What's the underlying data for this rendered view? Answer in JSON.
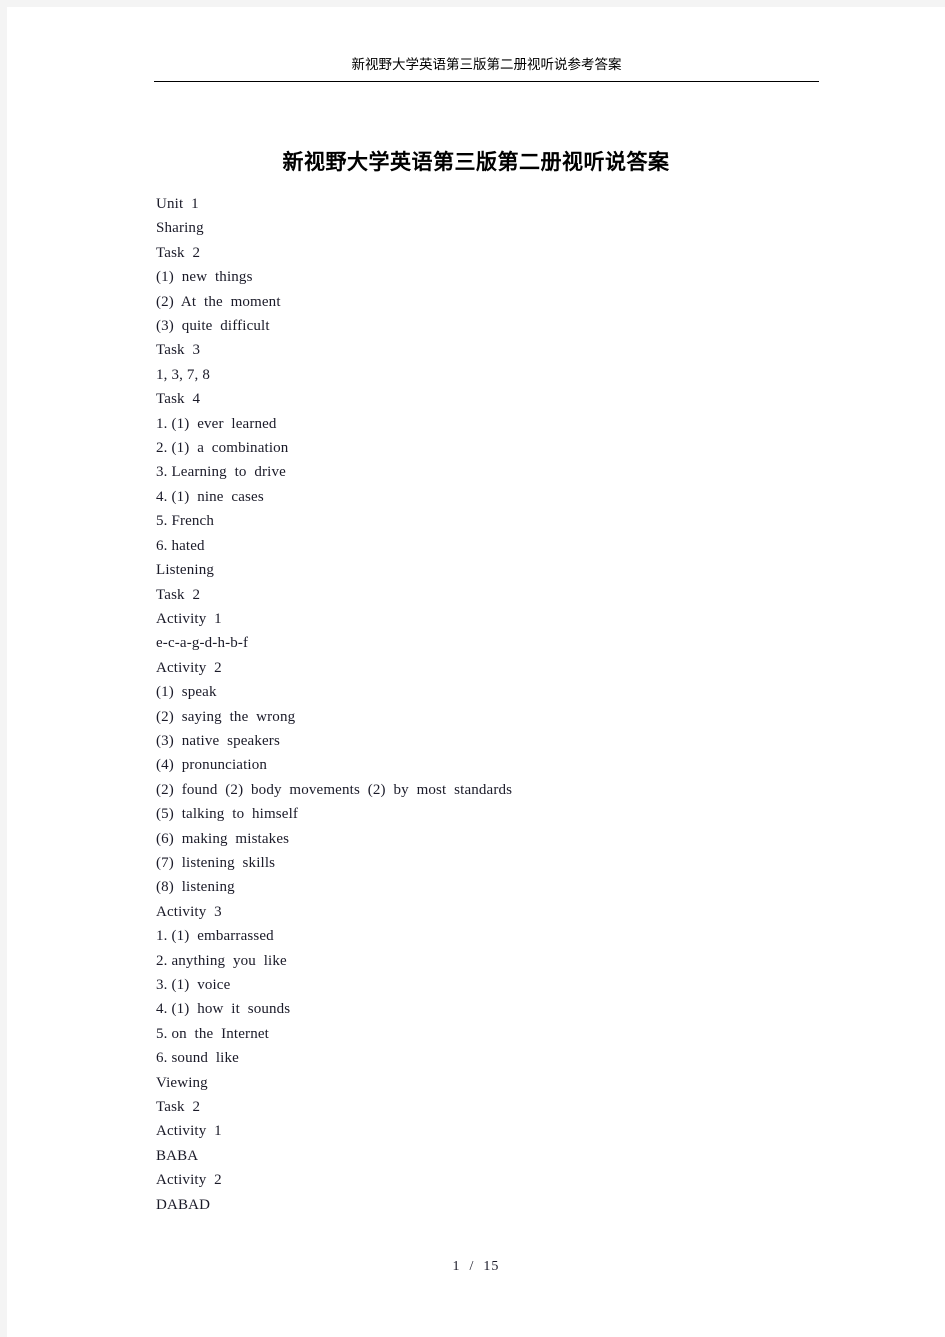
{
  "page": {
    "background_color": "#ffffff",
    "canvas_color": "#f4f4f4"
  },
  "header": {
    "text": "新视野大学英语第三版第二册视听说参考答案",
    "rule_color": "#000000"
  },
  "title": {
    "text": "新视野大学英语第三版第二册视听说答案"
  },
  "body": {
    "lines": [
      "Unit  1",
      "Sharing",
      "Task  2",
      "(1)  new  things",
      "(2)  At  the  moment",
      "(3)  quite  difficult",
      "Task  3",
      "1, 3, 7, 8",
      "Task  4",
      "1. (1)  ever  learned",
      "2. (1)  a  combination",
      "3. Learning  to  drive",
      "4. (1)  nine  cases",
      "5. French",
      "6. hated",
      "Listening",
      "Task  2",
      "Activity  1",
      "e-c-a-g-d-h-b-f",
      "Activity  2",
      "(1)  speak",
      "(2)  saying  the  wrong",
      "(3)  native  speakers",
      "(4)  pronunciation",
      "(2)  found  (2)  body  movements  (2)  by  most  standards",
      "(5)  talking  to  himself",
      "(6)  making  mistakes",
      "(7)  listening  skills",
      "(8)  listening",
      "Activity  3",
      "1. (1)  embarrassed",
      "2. anything  you  like",
      "3. (1)  voice",
      "4. (1)  how  it  sounds",
      "5. on  the  Internet",
      "6. sound  like",
      "Viewing",
      "Task  2",
      "Activity  1",
      "BABA",
      "Activity  2",
      "DABAD"
    ]
  },
  "footer": {
    "text": "1  /  15",
    "current_page": 1,
    "total_pages": 15
  }
}
